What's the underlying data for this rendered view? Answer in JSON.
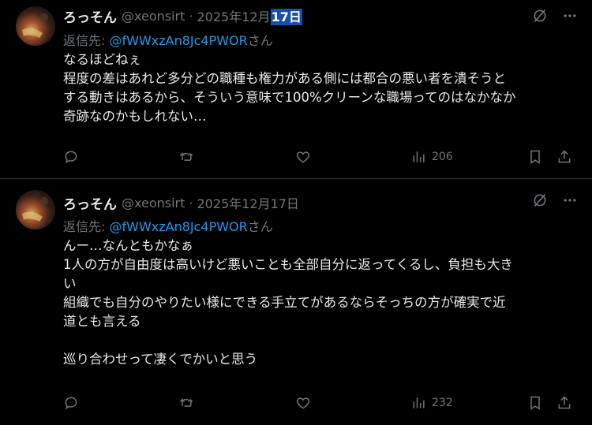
{
  "posts": [
    {
      "display_name": "ろっそん",
      "handle": "@xeonsirt",
      "separator": "·",
      "date_prefix": "2025年12月",
      "date_highlight": "17日",
      "reply_label": "返信先: ",
      "reply_mention": "@fWWxzAn8Jc4PWOR",
      "reply_suffix": "さん",
      "lines": [
        "なるほどねぇ",
        "程度の差はあれど多分どの職種も権力がある側には都合の悪い者を潰そうと",
        "する動きはあるから、そういう意味で100%クリーンな職場ってのはなかなか",
        "奇跡なのかもしれない…"
      ],
      "views": "206"
    },
    {
      "display_name": "ろっそん",
      "handle": "@xeonsirt",
      "separator": "·",
      "date": "2025年12月17日",
      "reply_label": "返信先: ",
      "reply_mention": "@fWWxzAn8Jc4PWOR",
      "reply_suffix": "さん",
      "lines": [
        "んー…なんともかなぁ",
        "1人の方が自由度は高いけど悪いことも全部自分に返ってくるし、負担も大き",
        "い",
        "組織でも自分のやりたい様にできる手立てがあるならそっちの方が確実で近",
        "道とも言える",
        "",
        "巡り合わせって凄くでかいと思う"
      ],
      "views": "232"
    }
  ],
  "icons": {
    "grok": "grok-slash-circle-icon",
    "more": "more-dots-icon",
    "reply": "reply-bubble-icon",
    "repost": "repost-icon",
    "like": "heart-icon",
    "views": "views-bar-chart-icon",
    "bookmark": "bookmark-icon",
    "share": "share-upload-icon"
  },
  "colors": {
    "background": "#000000",
    "text": "#e7e9ea",
    "muted": "#71767b",
    "link": "#1d9bf0",
    "highlight": "#1a4fa8",
    "divider": "#2f3336"
  }
}
